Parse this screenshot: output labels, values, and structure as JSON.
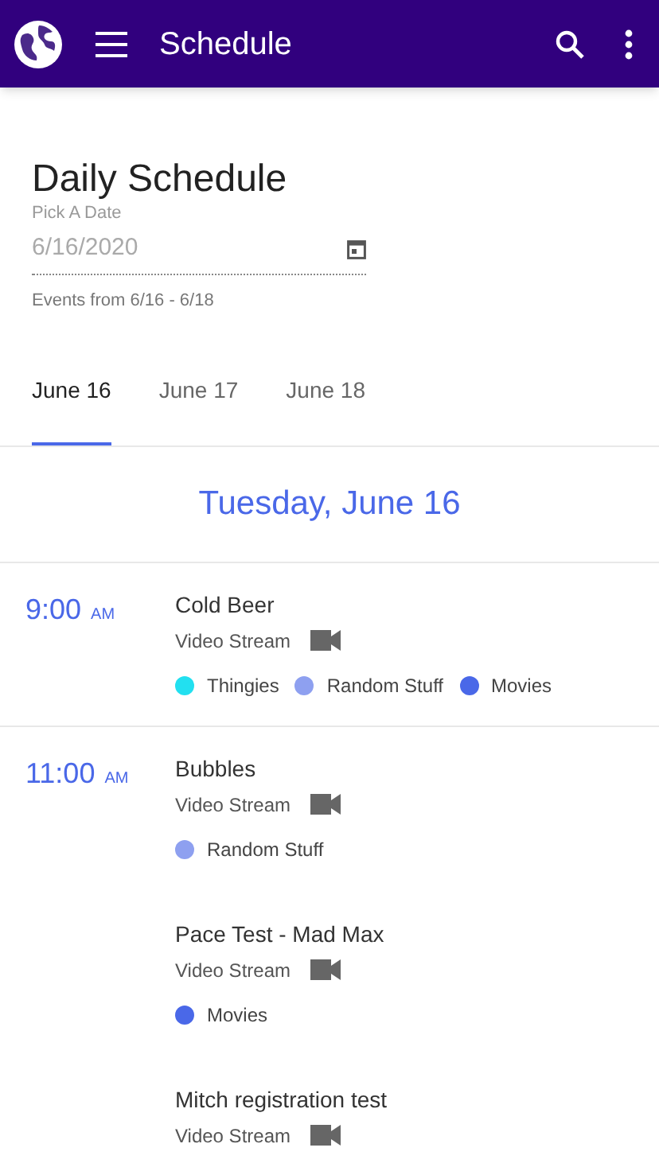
{
  "app_bar": {
    "title": "Schedule"
  },
  "page_title": "Daily Schedule",
  "date_field": {
    "label": "Pick A Date",
    "value": "6/16/2020",
    "hint": "Events from 6/16 - 6/18"
  },
  "tabs": [
    {
      "label": "June 16",
      "selected": true
    },
    {
      "label": "June 17",
      "selected": false
    },
    {
      "label": "June 18",
      "selected": false
    }
  ],
  "day_heading": "Tuesday, June 16",
  "slots": [
    {
      "time": "9:00",
      "meridiem": "AM",
      "events": [
        {
          "title": "Cold Beer",
          "type": "Video Stream",
          "tags": [
            {
              "label": "Thingies",
              "color": "#22e0f0"
            },
            {
              "label": "Random Stuff",
              "color": "#8ea0f0"
            },
            {
              "label": "Movies",
              "color": "#4a68e8"
            }
          ]
        }
      ]
    },
    {
      "time": "11:00",
      "meridiem": "AM",
      "events": [
        {
          "title": "Bubbles",
          "type": "Video Stream",
          "tags": [
            {
              "label": "Random Stuff",
              "color": "#8ea0f0"
            }
          ]
        },
        {
          "title": "Pace Test - Mad Max",
          "type": "Video Stream",
          "tags": [
            {
              "label": "Movies",
              "color": "#4a68e8"
            }
          ]
        },
        {
          "title": "Mitch registration test",
          "type": "Video Stream"
        }
      ]
    }
  ]
}
